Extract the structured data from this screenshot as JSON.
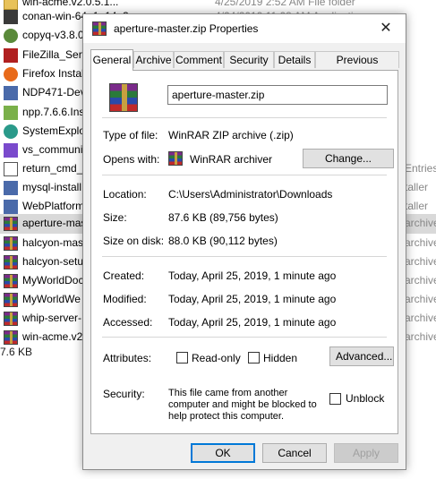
{
  "background": {
    "rows": [
      {
        "name": "win-acme.v2.0.5.1...",
        "extra": "4/25/2019 2:52 AM      File folder",
        "icon": "folder-icon"
      },
      {
        "name": "conan-win-64_1_14_3",
        "extra": "4/24/2019 11:08 AM      Application",
        "icon": "exe-icon"
      },
      {
        "name": "copyq-v3.8.0",
        "extra": "",
        "icon": "app-icon"
      },
      {
        "name": "FileZilla_Serv",
        "extra": "",
        "icon": "filezilla-icon"
      },
      {
        "name": "Firefox Install",
        "extra": "",
        "icon": "firefox-icon"
      },
      {
        "name": "NDP471-Dev",
        "extra": "",
        "icon": "installer-icon"
      },
      {
        "name": "npp.7.6.6.Inst",
        "extra": "",
        "icon": "notepadpp-icon"
      },
      {
        "name": "SystemExplo",
        "extra": "",
        "icon": "app-icon"
      },
      {
        "name": "vs_communi",
        "extra": "",
        "icon": "visual-studio-icon"
      },
      {
        "name": "return_cmd_",
        "extra": "Entries",
        "icon": "shortcut-icon"
      },
      {
        "name": "mysql-install",
        "extra": "taller",
        "icon": "installer-icon"
      },
      {
        "name": "WebPlatform",
        "extra": "taller",
        "icon": "installer-icon"
      },
      {
        "name": "aperture-mas",
        "extra": "archive",
        "icon": "rar-icon"
      },
      {
        "name": "halcyon-mas",
        "extra": "archive",
        "icon": "rar-icon"
      },
      {
        "name": "halcyon-setu",
        "extra": "archive",
        "icon": "rar-icon"
      },
      {
        "name": "MyWorldDoc",
        "extra": "archive",
        "icon": "rar-icon"
      },
      {
        "name": "MyWorldWe",
        "extra": "archive",
        "icon": "rar-icon"
      },
      {
        "name": "whip-server-",
        "extra": "archive",
        "icon": "rar-icon"
      },
      {
        "name": "win-acme.v2",
        "extra": "archive",
        "icon": "rar-icon"
      }
    ],
    "status": "7.6 KB"
  },
  "dialog": {
    "title": "aperture-master.zip Properties",
    "close_glyph": "✕",
    "tabs": [
      "General",
      "Archive",
      "Comment",
      "Security",
      "Details",
      "Previous Versions"
    ],
    "filename": "aperture-master.zip",
    "type_label": "Type of file:",
    "type_value": "WinRAR ZIP archive (.zip)",
    "opens_label": "Opens with:",
    "opens_value": "WinRAR archiver",
    "change_button": "Change...",
    "location_label": "Location:",
    "location_value": "C:\\Users\\Administrator\\Downloads",
    "size_label": "Size:",
    "size_value": "87.6 KB (89,756 bytes)",
    "size_disk_label": "Size on disk:",
    "size_disk_value": "88.0 KB (90,112 bytes)",
    "created_label": "Created:",
    "created_value": "Today, April 25, 2019, 1 minute ago",
    "modified_label": "Modified:",
    "modified_value": "Today, April 25, 2019, 1 minute ago",
    "accessed_label": "Accessed:",
    "accessed_value": "Today, April 25, 2019, 1 minute ago",
    "attributes_label": "Attributes:",
    "readonly_label": "Read-only",
    "hidden_label": "Hidden",
    "advanced_button": "Advanced...",
    "security_label": "Security:",
    "security_text": "This file came from another computer and might be blocked to help protect this computer.",
    "unblock_label": "Unblock",
    "ok_button": "OK",
    "cancel_button": "Cancel",
    "apply_button": "Apply"
  }
}
